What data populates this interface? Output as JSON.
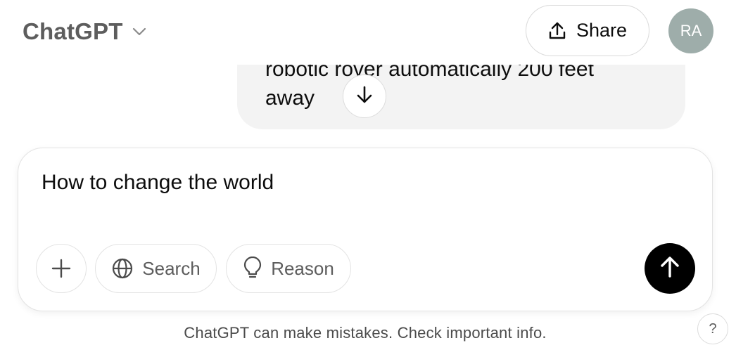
{
  "header": {
    "model_name": "ChatGPT",
    "share_label": "Share",
    "avatar_initials": "RA",
    "icons": {
      "model_menu": "chevron-down-icon",
      "share": "upload-icon"
    }
  },
  "conversation": {
    "partial_line": "robotic rover automatically 200 feet",
    "last_line": "away",
    "scroll_icon": "arrow-down-icon"
  },
  "composer": {
    "input_value": "How to change the world",
    "tools": [
      {
        "label": "",
        "icon": "plus-icon"
      },
      {
        "label": "Search",
        "icon": "globe-icon"
      },
      {
        "label": "Reason",
        "icon": "lightbulb-icon"
      }
    ],
    "send_icon": "arrow-up-icon"
  },
  "footer": {
    "disclaimer": "ChatGPT can make mistakes. Check important info.",
    "help_label": "?"
  },
  "colors": {
    "bubble": "#f3f3f3",
    "avatar": "#9eadaa",
    "send_button": "#000000",
    "muted_text": "#5d5d5d"
  }
}
